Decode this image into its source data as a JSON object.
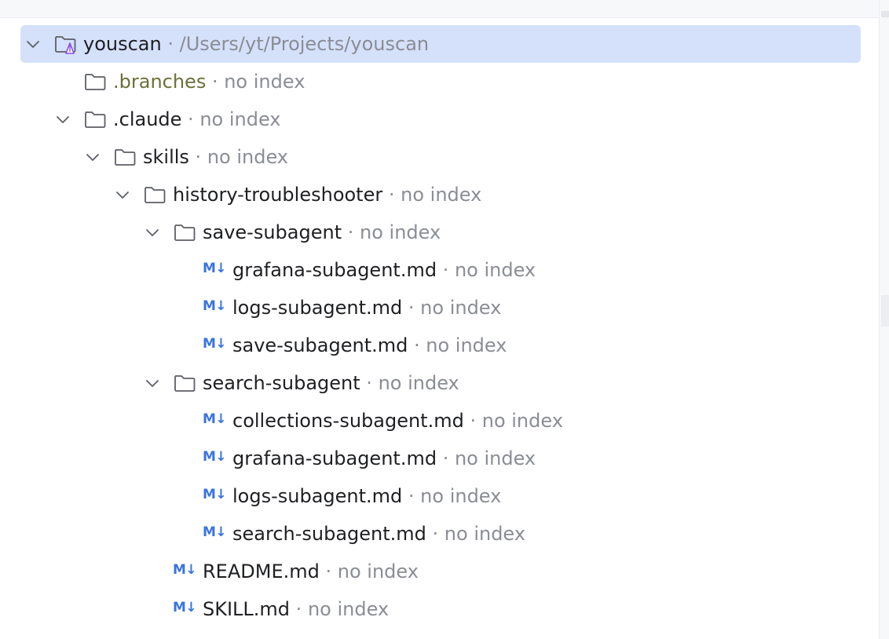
{
  "tree": {
    "root": {
      "name": "youscan",
      "path": "/Users/yt/Projects/youscan",
      "separator": " · "
    },
    "rows": [
      {
        "name": ".branches",
        "hint": "no index"
      },
      {
        "name": ".claude",
        "hint": "no index"
      },
      {
        "name": "skills",
        "hint": "no index"
      },
      {
        "name": "history-troubleshooter",
        "hint": "no index"
      },
      {
        "name": "save-subagent",
        "hint": "no index"
      },
      {
        "name": "grafana-subagent.md",
        "hint": "no index"
      },
      {
        "name": "logs-subagent.md",
        "hint": "no index"
      },
      {
        "name": "save-subagent.md",
        "hint": "no index"
      },
      {
        "name": "search-subagent",
        "hint": "no index"
      },
      {
        "name": "collections-subagent.md",
        "hint": "no index"
      },
      {
        "name": "grafana-subagent.md",
        "hint": "no index"
      },
      {
        "name": "logs-subagent.md",
        "hint": "no index"
      },
      {
        "name": "search-subagent.md",
        "hint": "no index"
      },
      {
        "name": "README.md",
        "hint": "no index"
      },
      {
        "name": "SKILL.md",
        "hint": "no index"
      }
    ],
    "separator": " · ",
    "md_icon_text": "M↓"
  },
  "colors": {
    "selection": "#d5e0fb",
    "excluded_folder": "#6c7038",
    "hint": "#8a8d94",
    "markdown_icon": "#3a74e0",
    "module_icon_accent": "#8a4de8"
  },
  "icons": {
    "expand": "chevron-down-icon",
    "folder": "folder-icon",
    "module": "module-folder-icon",
    "markdown": "markdown-file-icon"
  }
}
